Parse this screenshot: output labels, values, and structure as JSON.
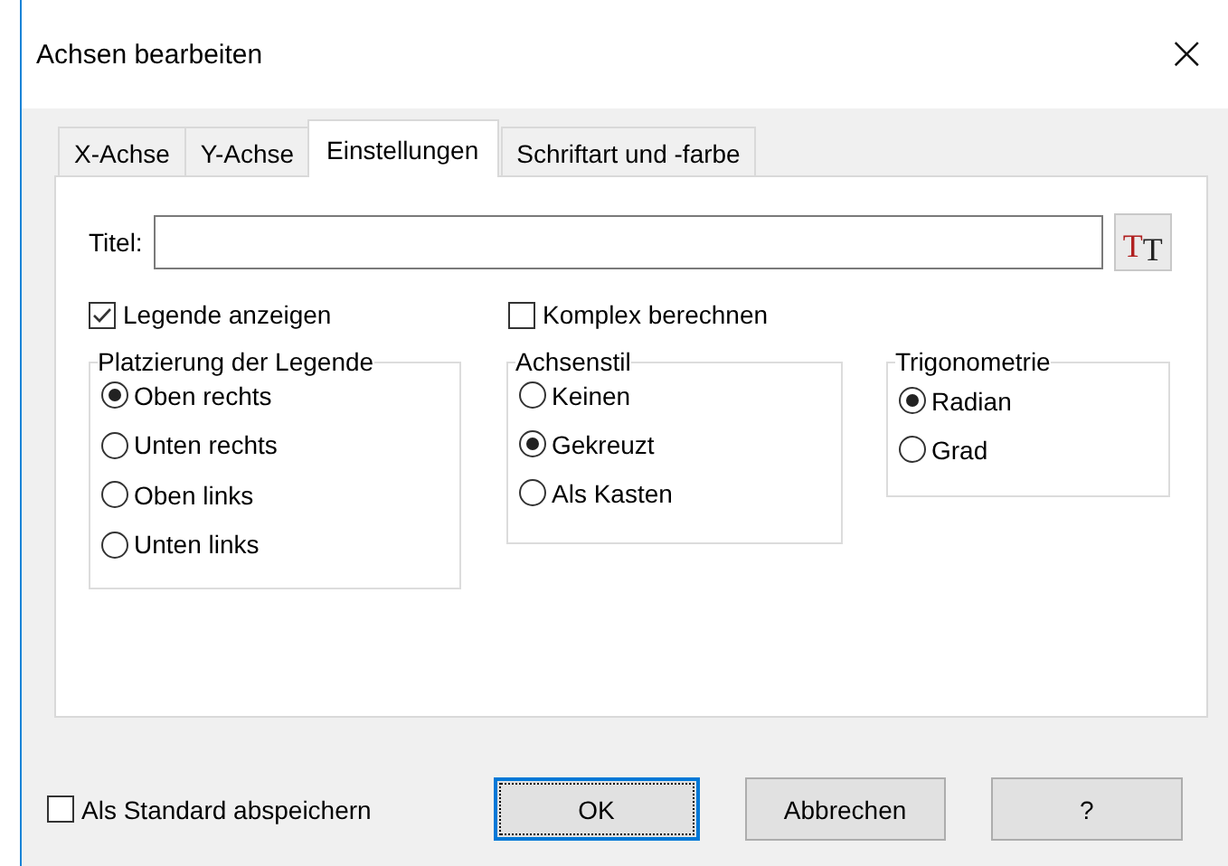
{
  "window": {
    "title": "Achsen bearbeiten",
    "close": "×"
  },
  "tabs": [
    {
      "label": "X-Achse",
      "selected": false
    },
    {
      "label": "Y-Achse",
      "selected": false
    },
    {
      "label": "Einstellungen",
      "selected": true
    },
    {
      "label": "Schriftart und -farbe",
      "selected": false
    }
  ],
  "title_field": {
    "label": "Titel:"
  },
  "font_button": {
    "letters": [
      "T",
      "T"
    ]
  },
  "options": [
    {
      "label": "Legende anzeigen",
      "checked": true
    },
    {
      "label": "Komplex berechnen",
      "checked": false
    }
  ],
  "groups": [
    {
      "title": "Platzierung der Legende",
      "items": [
        {
          "label": "Oben rechts",
          "selected": true
        },
        {
          "label": "Unten rechts",
          "selected": false
        },
        {
          "label": "Oben links",
          "selected": false
        },
        {
          "label": "Unten links",
          "selected": false
        }
      ]
    },
    {
      "title": "Achsenstil",
      "items": [
        {
          "label": "Keinen",
          "selected": false
        },
        {
          "label": "Gekreuzt",
          "selected": true
        },
        {
          "label": "Als Kasten",
          "selected": false
        }
      ]
    },
    {
      "title": "Trigonometrie",
      "items": [
        {
          "label": "Radian",
          "selected": true
        },
        {
          "label": "Grad",
          "selected": false
        }
      ]
    }
  ],
  "save_default": {
    "label": "Als Standard abspeichern",
    "checked": false
  },
  "buttons": [
    {
      "label": "OK",
      "default": true
    },
    {
      "label": "Abbrechen",
      "default": false
    },
    {
      "label": "?",
      "default": false
    }
  ]
}
